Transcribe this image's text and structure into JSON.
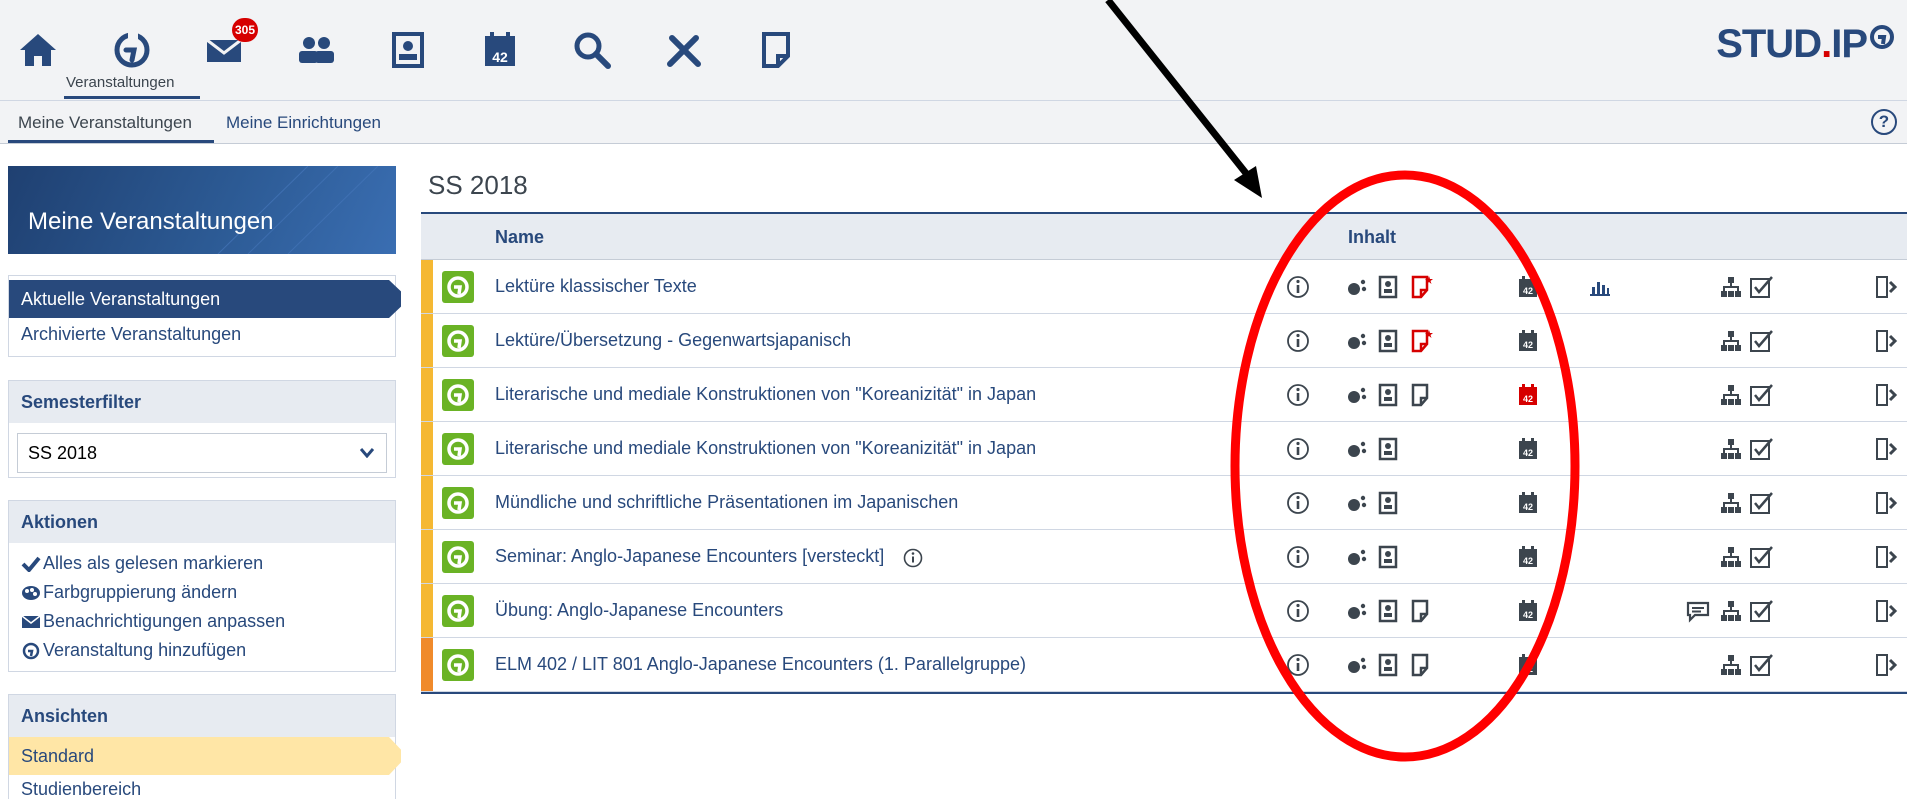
{
  "topbar": {
    "nav_label": "Veranstaltungen",
    "messages_badge": "305",
    "calendar_number": "42",
    "logo_text_main": "STUD",
    "logo_text_dot": ".",
    "logo_text_end": "IP",
    "icons": [
      "home-icon",
      "courses-icon",
      "messages-icon",
      "community-icon",
      "profile-icon",
      "calendar-icon",
      "search-icon",
      "tools-icon",
      "files-icon"
    ]
  },
  "subnav": {
    "tabs": [
      "Meine Veranstaltungen",
      "Meine Einrichtungen"
    ],
    "help": "?"
  },
  "sidebar": {
    "title": "Meine Veranstaltungen",
    "nav": [
      "Aktuelle Veranstaltungen",
      "Archivierte Veranstaltungen"
    ],
    "filter_header": "Semesterfilter",
    "semester_value": "SS 2018",
    "actions_header": "Aktionen",
    "actions": [
      "Alles als gelesen markieren",
      "Farbgruppierung ändern",
      "Benachrichtigungen anpassen",
      "Veranstaltung hinzufügen"
    ],
    "views_header": "Ansichten",
    "views": [
      "Standard",
      "Studienbereich"
    ]
  },
  "main": {
    "semester_title": "SS 2018",
    "col_name": "Name",
    "col_inhalt": "Inhalt",
    "calendar_number": "42",
    "rows": [
      {
        "name": "Lektüre klassischer Texte",
        "group_color": "#f5b833"
      },
      {
        "name": "Lektüre/Übersetzung - Gegenwartsjapanisch",
        "group_color": "#f5b833"
      },
      {
        "name": "Literarische und mediale Konstruktionen von \"Koreanizität\" in Japan",
        "group_color": "#f5b833"
      },
      {
        "name": "Literarische und mediale Konstruktionen von \"Koreanizität\" in Japan",
        "group_color": "#f5b833"
      },
      {
        "name": "Mündliche und schriftliche Präsentationen im Japanischen",
        "group_color": "#f5b833"
      },
      {
        "name": "Seminar: Anglo-Japanese Encounters [versteckt]",
        "group_color": "#f5b833"
      },
      {
        "name": "Übung: Anglo-Japanese Encounters",
        "group_color": "#f5b833"
      },
      {
        "name": "ELM 402 / LIT 801 Anglo-Japanese Encounters (1. Parallelgruppe)",
        "group_color": "#f08a2b"
      }
    ]
  },
  "colors": {
    "brand_blue": "#28497c",
    "course_green": "#6ab325",
    "alert_red": "#d60000",
    "annotation_red": "#ff0000"
  }
}
